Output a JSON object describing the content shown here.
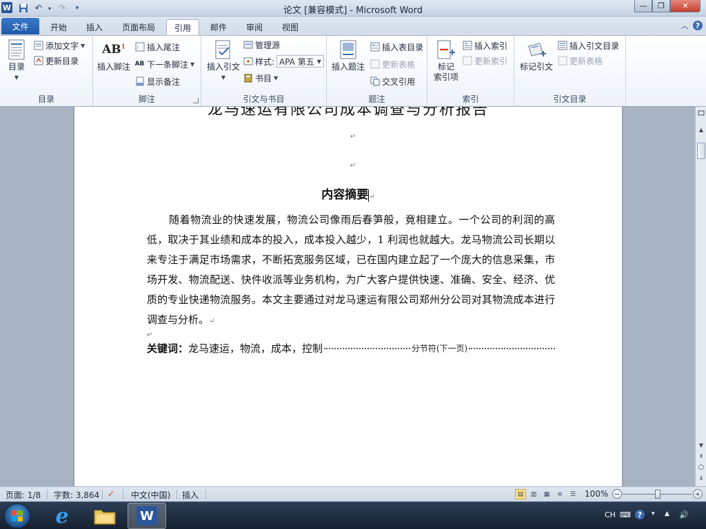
{
  "window": {
    "title": "论文 [兼容模式]  -  Microsoft Word",
    "app_icon_letter": "W"
  },
  "tabs": {
    "file": "文件",
    "items": [
      "开始",
      "插入",
      "页面布局",
      "引用",
      "邮件",
      "审阅",
      "视图"
    ],
    "active": "引用"
  },
  "ribbon": {
    "toc_group": {
      "label": "目录",
      "toc_button": "目录",
      "add_text": "添加文字",
      "update_toc": "更新目录"
    },
    "footnote_group": {
      "label": "脚注",
      "insert_footnote": "插入脚注",
      "insert_endnote": "插入尾注",
      "next_footnote": "下一条脚注",
      "show_notes": "显示备注"
    },
    "citation_group": {
      "label": "引文与书目",
      "insert_citation": "插入引文",
      "manage_sources": "管理源",
      "style_label": "样式:",
      "style_value": "APA 第五",
      "bibliography": "书目"
    },
    "caption_group": {
      "label": "题注",
      "insert_caption": "插入题注",
      "insert_table_of_figures": "插入表目录",
      "update_table": "更新表格",
      "cross_reference": "交叉引用"
    },
    "index_group": {
      "label": "索引",
      "mark_entry": "标记\n索引项",
      "mark_entry_line1": "标记",
      "mark_entry_line2": "索引项",
      "insert_index": "插入索引",
      "update_index": "更新索引"
    },
    "toa_group": {
      "label": "引文目录",
      "mark_citation": "标记引文",
      "insert_toa": "插入引文目录",
      "update_table": "更新表格"
    }
  },
  "document": {
    "title": "龙马速运有限公司成本调查与分析报告",
    "heading": "内容摘要",
    "body": "随着物流业的快速发展，物流公司像雨后春笋般，竟相建立。一个公司的利润的高低，取决于其业绩和成本的投入，成本投入越少，1 利润也就越大。龙马物流公司长期以来专注于满足市场需求，不断拓宽服务区域，已在国内建立起了一个庞大的信息采集，市场开发、物流配送、快件收派等业务机构，为广大客户提供快速、准确、安全、经济、优质的专业快递物流服务。本文主要通过对龙马速运有限公司郑州分公司对其物流成本进行调查与分析。",
    "keywords_label": "关键词：",
    "keywords": "龙马速运，物流，成本，控制",
    "section_break": "分节符(下一页)",
    "para_mark": "↵"
  },
  "statusbar": {
    "page": "页面: 1/8",
    "words": "字数: 3,864",
    "language": "中文(中国)",
    "mode": "插入",
    "zoom": "100%"
  },
  "taskbar": {
    "lang": "CH"
  },
  "colors": {
    "file_tab": "#1e5aa8",
    "accent": "#2b579a"
  }
}
